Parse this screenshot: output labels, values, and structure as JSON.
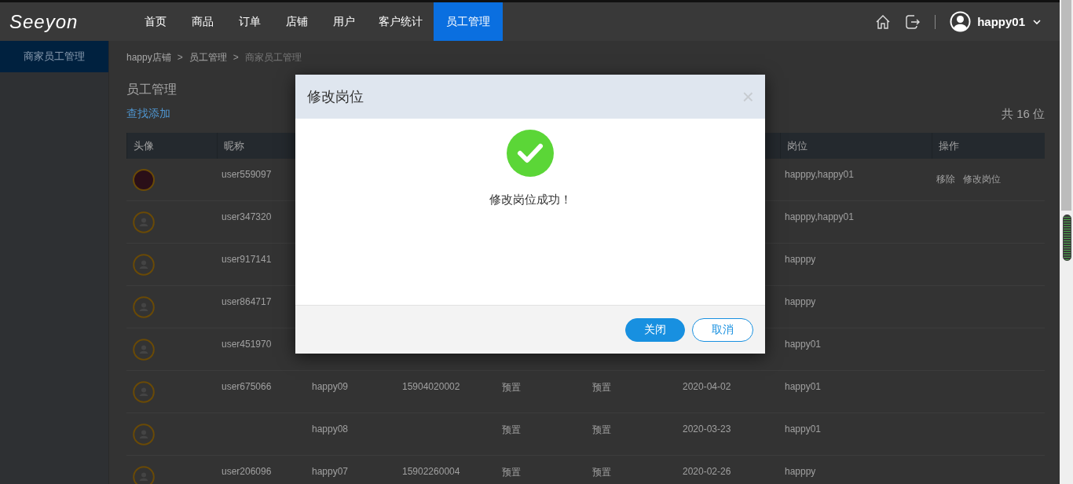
{
  "header": {
    "logo": "Seeyon",
    "nav": [
      {
        "label": "首页",
        "selected": false
      },
      {
        "label": "商品",
        "selected": false
      },
      {
        "label": "订单",
        "selected": false
      },
      {
        "label": "店铺",
        "selected": false
      },
      {
        "label": "用户",
        "selected": false
      },
      {
        "label": "客户统计",
        "selected": false
      },
      {
        "label": "员工管理",
        "selected": true
      }
    ],
    "username": "happy01"
  },
  "sidebar": {
    "items": [
      {
        "label": "商家员工管理",
        "selected": true
      }
    ]
  },
  "breadcrumb": [
    {
      "label": "happy店铺",
      "current": false
    },
    {
      "label": "员工管理",
      "current": false
    },
    {
      "label": "商家员工管理",
      "current": true
    }
  ],
  "separator": ">",
  "page_title": "员工管理",
  "search_link": "查找添加",
  "total": "共 16 位",
  "table": {
    "columns": [
      {
        "label": "头像"
      },
      {
        "label": "昵称"
      },
      {},
      {},
      {},
      {},
      {},
      {
        "label": "岗位"
      },
      {
        "label": "操作"
      }
    ],
    "rows": [
      {
        "kind": "photo",
        "nickname": "user559097",
        "position": "happpy,happy01",
        "actions": [
          "移除",
          "修改岗位"
        ]
      },
      {
        "kind": "default",
        "nickname": "user347320",
        "position": "happpy,happy01"
      },
      {
        "kind": "default",
        "nickname": "user917141",
        "position": "happpy"
      },
      {
        "kind": "default",
        "nickname": "user864717",
        "position": "happpy"
      },
      {
        "kind": "default",
        "nickname": "user451970",
        "position": "happy01"
      },
      {
        "kind": "default",
        "nickname": "user675066",
        "column_3": "happy09",
        "column_4": "15904020002",
        "column_5": "预置",
        "column_6": "预置",
        "column_7": "2020-04-02",
        "position": "happy01"
      },
      {
        "kind": "default",
        "column_3": "happy08",
        "column_5": "预置",
        "column_6": "预置",
        "column_7": "2020-03-23",
        "position": "happy01"
      },
      {
        "kind": "default",
        "nickname": "user206096",
        "column_3": "happy07",
        "column_4": "15902260004",
        "column_5": "预置",
        "column_6": "预置",
        "column_7": "2020-02-26",
        "position": "happpy"
      }
    ]
  },
  "modal": {
    "title": "修改岗位",
    "close": "×",
    "message": "修改岗位成功！",
    "buttons": [
      {
        "label": "关闭",
        "kind": "primary"
      },
      {
        "label": "取消",
        "kind": "default"
      }
    ]
  }
}
